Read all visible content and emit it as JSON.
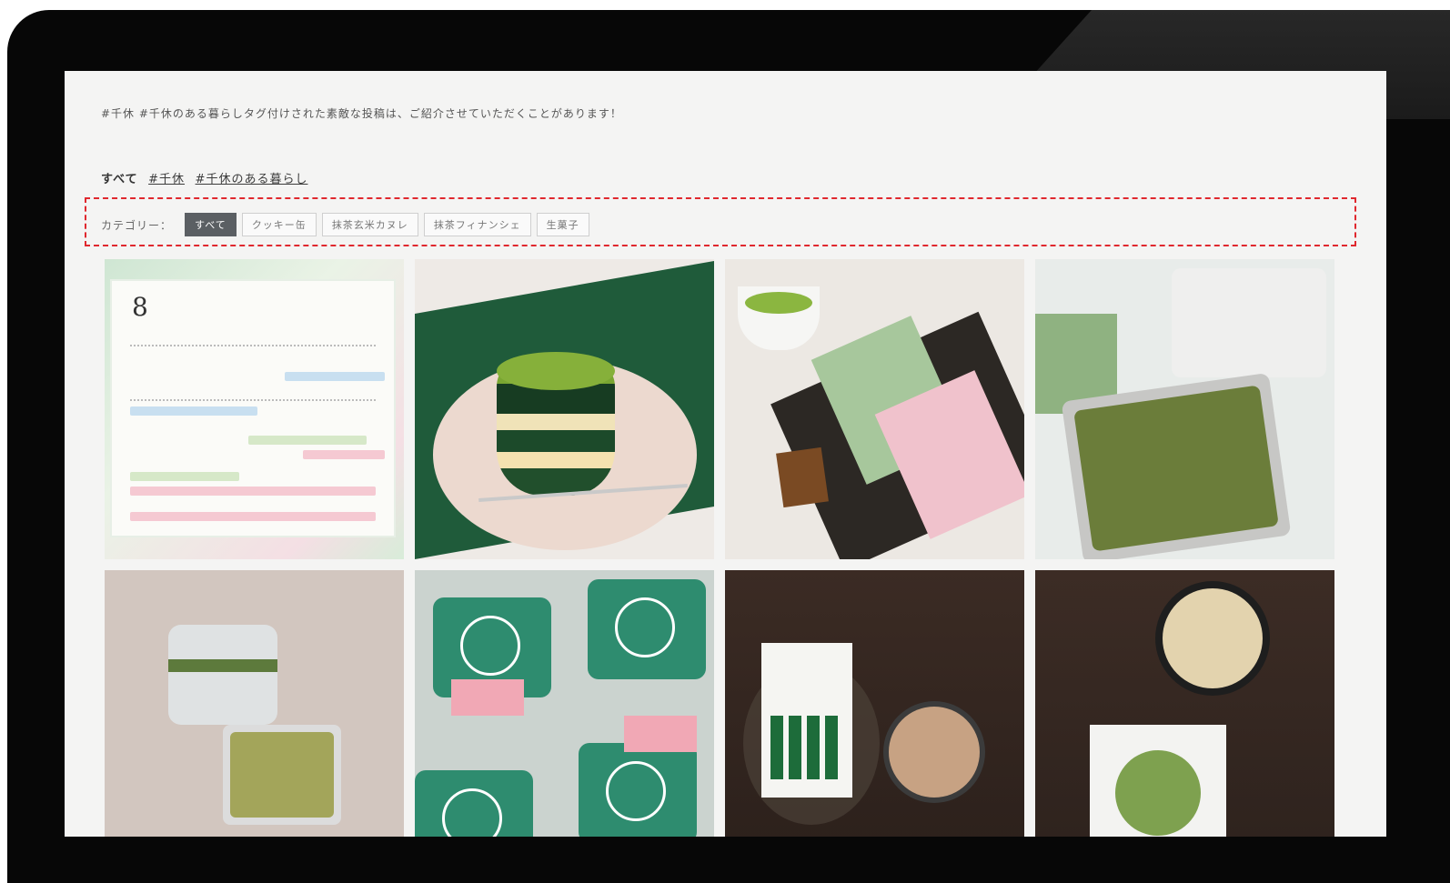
{
  "intro_text": "#千休 #千休のある暮らしタグ付けされた素敵な投稿は、ご紹介させていただくことがあります！",
  "tag_filter": {
    "all_label": "すべて",
    "tags": [
      "#千休",
      "#千休のある暮らし"
    ]
  },
  "category": {
    "label": "カテゴリー：",
    "buttons": [
      "すべて",
      "クッキー缶",
      "抹茶玄米カヌレ",
      "抹茶フィナンシェ",
      "生菓子"
    ],
    "active_index": 0
  },
  "calendar_tile": {
    "month": "8"
  },
  "grid_items": [
    "calendar",
    "tiramisu",
    "gift-box",
    "cookie-tin",
    "tin-ribbon",
    "packets",
    "tea-pack",
    "coffee-cookie"
  ],
  "colors": {
    "bezel": "#070707",
    "screen_bg": "#f4f4f3",
    "highlight_dash": "#e0282e",
    "active_button": "#5b5f63"
  }
}
